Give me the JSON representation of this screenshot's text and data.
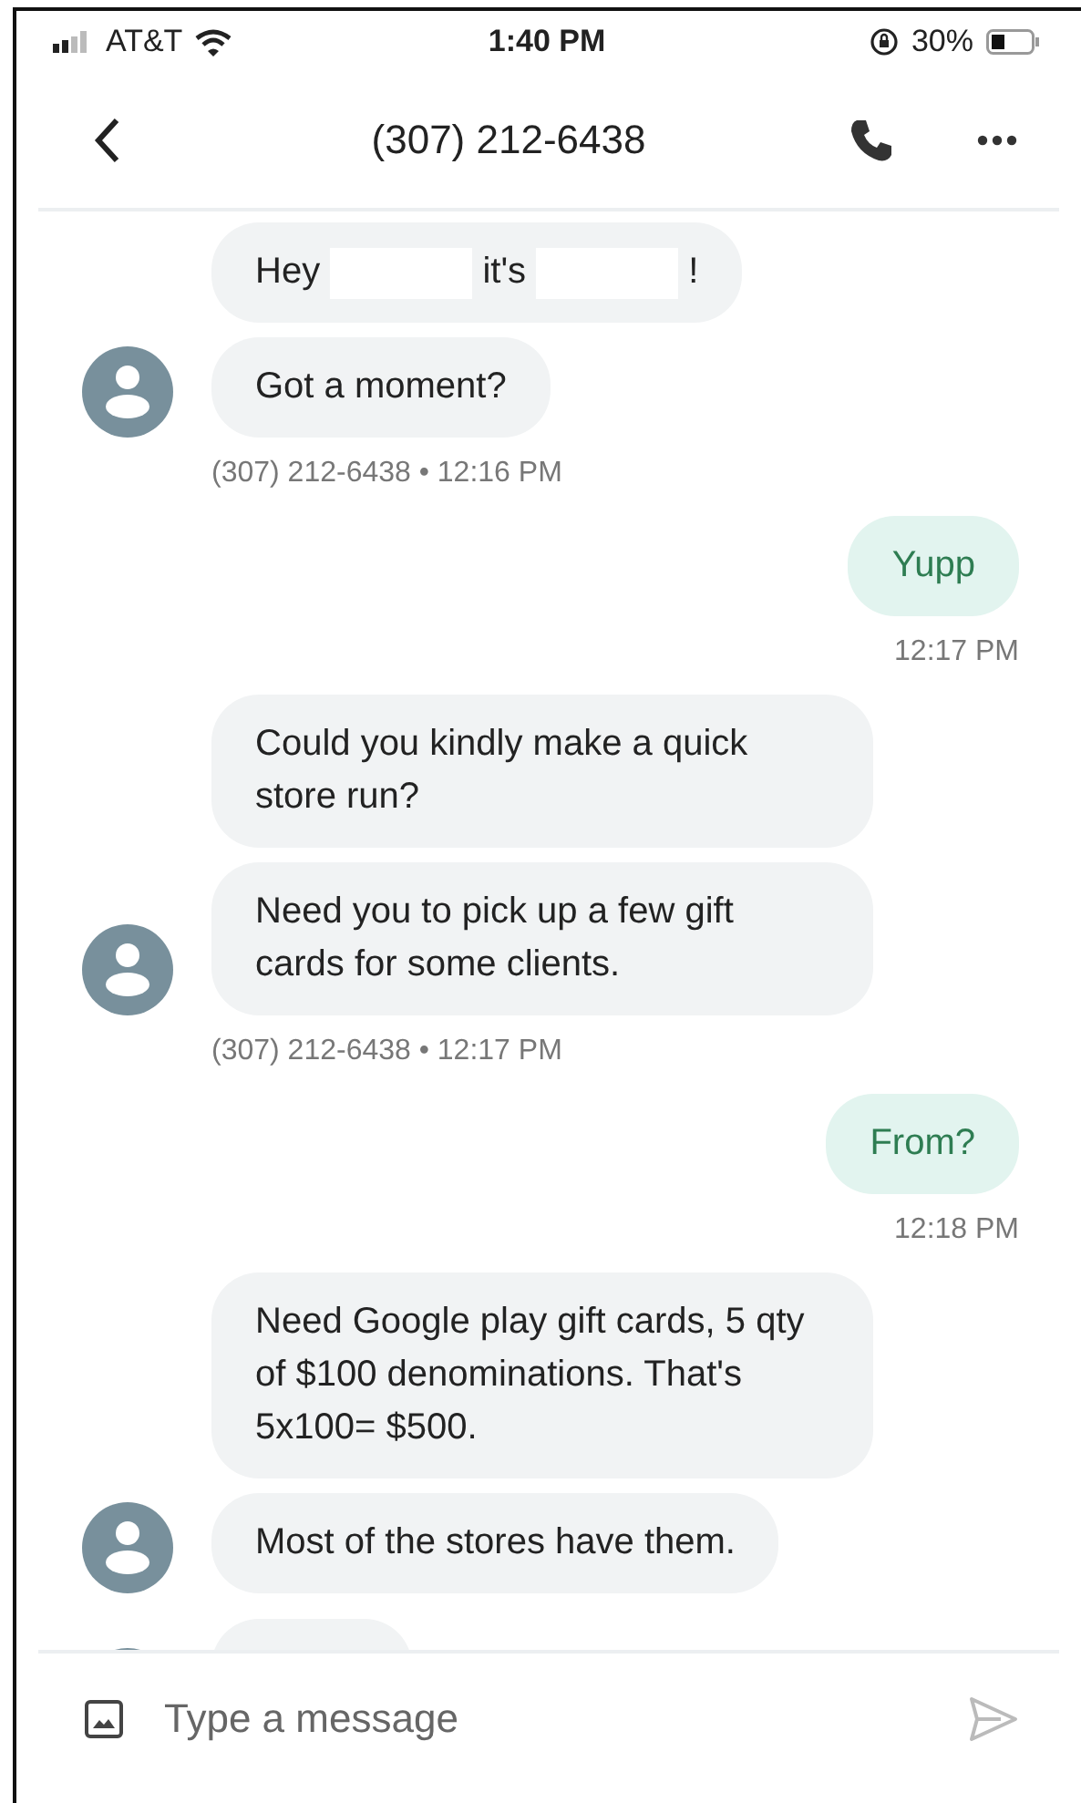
{
  "status_bar": {
    "carrier": "AT&T",
    "time": "1:40 PM",
    "battery": "30%"
  },
  "header": {
    "title": "(307) 212-6438"
  },
  "conversation": [
    {
      "kind": "incoming",
      "bubbles": [
        {
          "parts": [
            {
              "kind": "text",
              "text": "Hey"
            },
            {
              "kind": "redacted"
            },
            {
              "kind": "text",
              "text": "it's"
            },
            {
              "kind": "redacted"
            },
            {
              "kind": "text",
              "text": "!"
            }
          ]
        },
        {
          "parts": [
            {
              "kind": "text",
              "text": "Got a moment?"
            }
          ]
        }
      ],
      "meta": "(307) 212-6438 • 12:16 PM"
    },
    {
      "kind": "outgoing",
      "bubbles": [
        {
          "parts": [
            {
              "kind": "text",
              "text": "Yupp"
            }
          ]
        }
      ],
      "meta": "12:17 PM"
    },
    {
      "kind": "incoming",
      "bubbles": [
        {
          "parts": [
            {
              "kind": "text",
              "text": "Could you kindly make a quick store run?"
            }
          ]
        },
        {
          "parts": [
            {
              "kind": "text",
              "text": "Need you to pick up a few gift cards for some clients."
            }
          ]
        }
      ],
      "meta": "(307) 212-6438 • 12:17 PM"
    },
    {
      "kind": "outgoing",
      "bubbles": [
        {
          "parts": [
            {
              "kind": "text",
              "text": "From?"
            }
          ]
        }
      ],
      "meta": "12:18 PM"
    },
    {
      "kind": "incoming",
      "bubbles": [
        {
          "parts": [
            {
              "kind": "text",
              "text": "Need Google play gift cards, 5 qty of $100 denominations. That's 5x100= $500."
            }
          ]
        },
        {
          "parts": [
            {
              "kind": "text",
              "text": "Most of the stores have them."
            }
          ]
        }
      ]
    },
    {
      "kind": "incoming_partial"
    }
  ],
  "composer": {
    "placeholder": "Type a message"
  }
}
